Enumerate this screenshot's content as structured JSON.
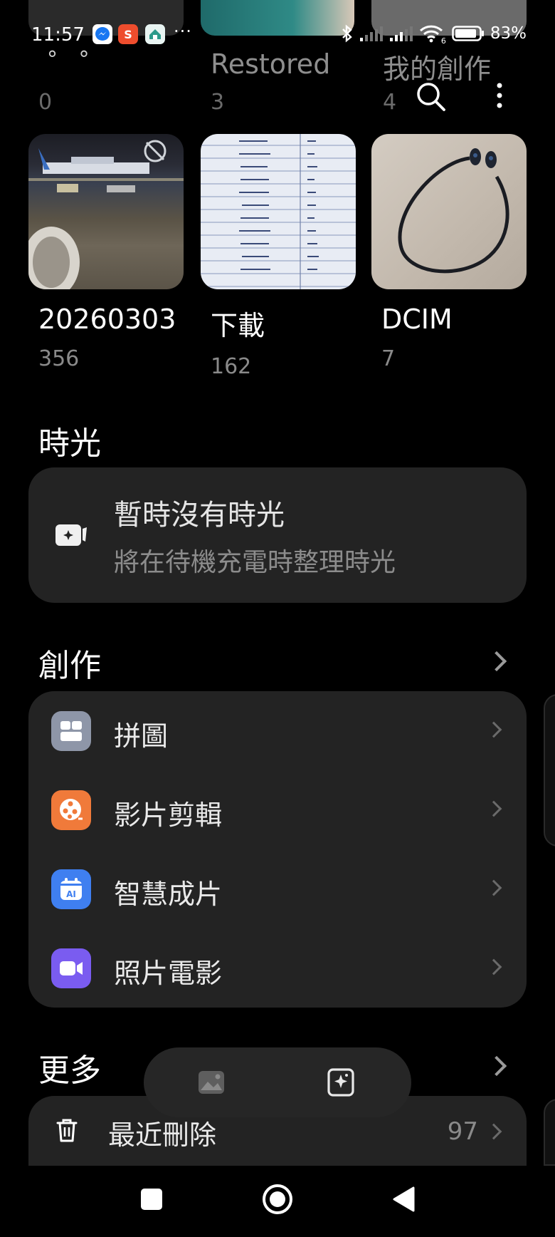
{
  "status": {
    "time": "11:57",
    "dots": "···",
    "battery_pct": "83%",
    "wifi_badge": "6",
    "apps": [
      {
        "icon": "messenger-icon",
        "color": "#1877f2"
      },
      {
        "icon": "shopee-icon",
        "color": "#ee4d2d"
      },
      {
        "icon": "app-icon",
        "color": "#2b9a8a"
      }
    ]
  },
  "albums_top": [
    {
      "name": "° °",
      "count": "0"
    },
    {
      "name": "Restored",
      "count": "3"
    },
    {
      "name": "我的創作",
      "count": "4"
    }
  ],
  "albums": [
    {
      "name": "20260303",
      "count": "356",
      "thumb": "airport-photo"
    },
    {
      "name": "下載",
      "count": "162",
      "thumb": "handwritten-list-photo"
    },
    {
      "name": "DCIM",
      "count": "7",
      "thumb": "earphones-photo"
    }
  ],
  "moments": {
    "title": "時光",
    "empty_title": "暫時沒有時光",
    "empty_sub": "將在待機充電時整理時光"
  },
  "create": {
    "title": "創作",
    "items": [
      {
        "label": "拼圖",
        "icon": "collage-icon",
        "color": "#8e96a8"
      },
      {
        "label": "影片剪輯",
        "icon": "film-reel-icon",
        "color": "#f07a3a"
      },
      {
        "label": "智慧成片",
        "icon": "ai-calendar-icon",
        "color": "#3f7ff0"
      },
      {
        "label": "照片電影",
        "icon": "video-camera-icon",
        "color": "#7a5cf0"
      }
    ]
  },
  "more": {
    "title": "更多",
    "recently_deleted_label": "最近刪除",
    "recently_deleted_count": "97"
  }
}
